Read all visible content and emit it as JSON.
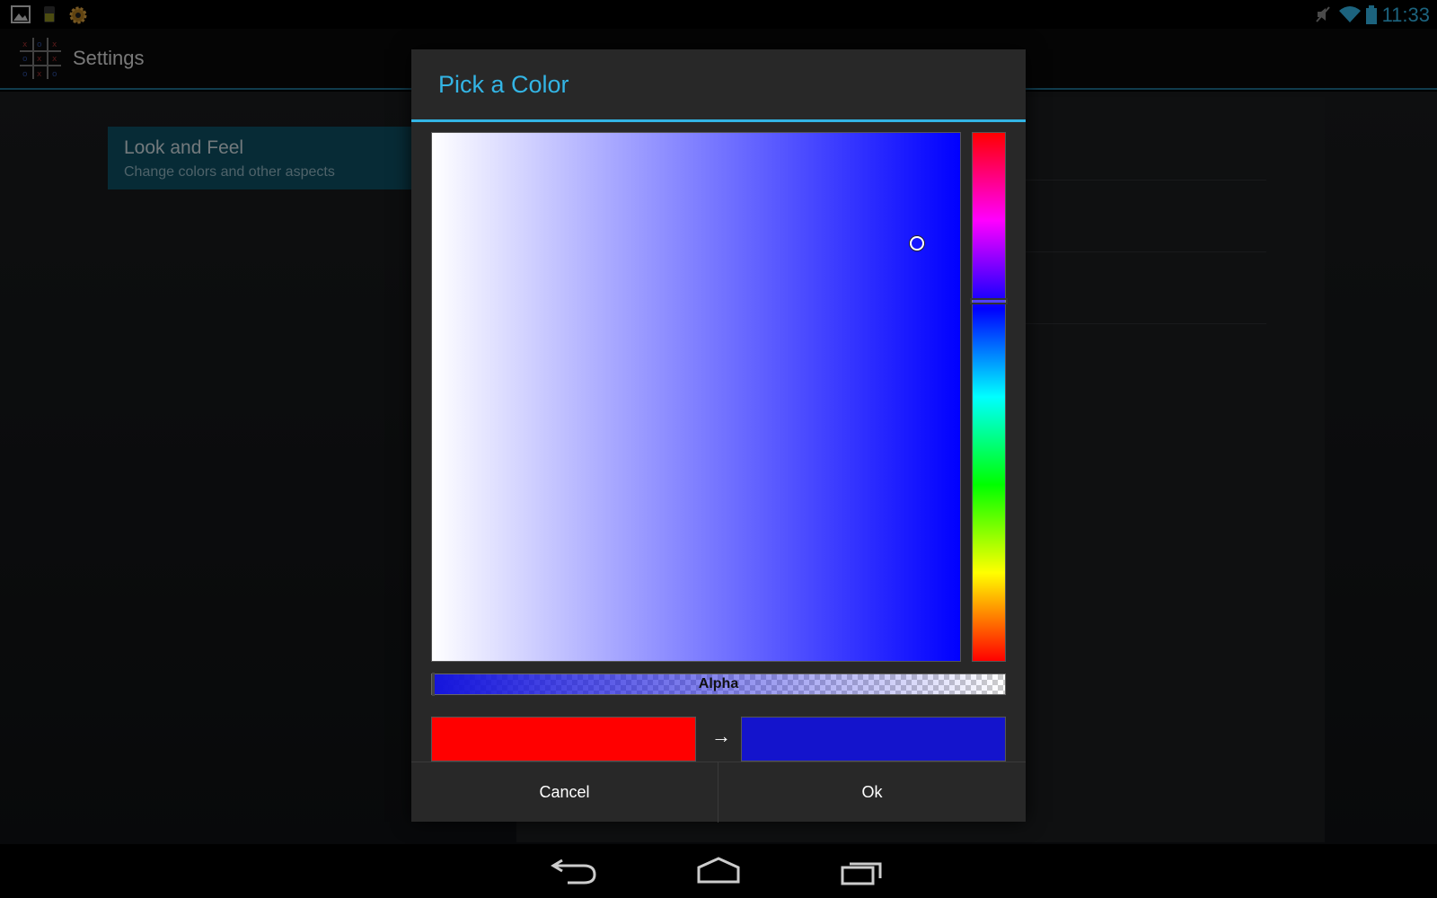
{
  "status_bar": {
    "time": "11:33",
    "left_icons": [
      "gallery-icon",
      "battery-app-icon",
      "settings-gear-icon"
    ],
    "right_icons": [
      "mute-icon",
      "wifi-icon",
      "battery-icon"
    ]
  },
  "action_bar": {
    "title": "Settings",
    "logo_icon": "tic-tac-toe-icon"
  },
  "preferences": {
    "header": {
      "title": "Look and Feel",
      "summary": "Change colors and other aspects"
    }
  },
  "dialog": {
    "title": "Pick a Color",
    "alpha_label": "Alpha",
    "arrow": "→",
    "cancel_label": "Cancel",
    "ok_label": "Ok",
    "colors": {
      "accent": "#33b5e5",
      "old_color": "#ff0000",
      "new_color": "#1414cc",
      "selected_hue": "#0000ff"
    }
  },
  "nav_bar": {
    "icons": [
      "back-icon",
      "home-icon",
      "recent-apps-icon"
    ]
  }
}
